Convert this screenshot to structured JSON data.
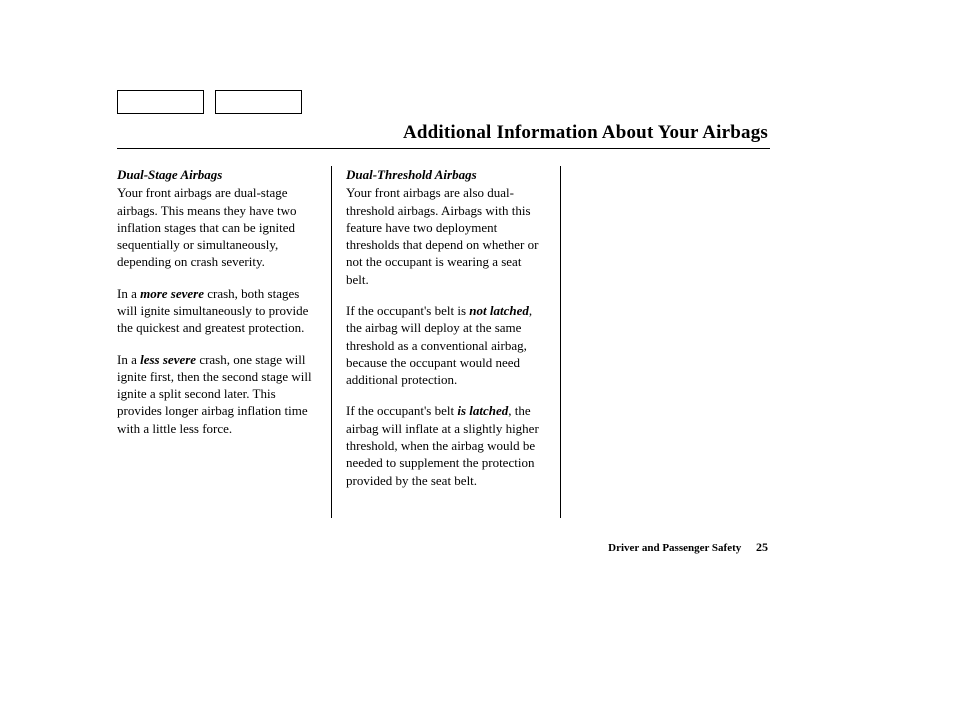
{
  "page_title": "Additional Information About Your Airbags",
  "footer": {
    "section": "Driver and Passenger Safety",
    "page_number": "25"
  },
  "col1": {
    "heading": "Dual-Stage Airbags",
    "p1": "Your front airbags are dual-stage airbags. This means they have two inflation stages that can be ignited sequentially or simultaneously, depending on crash severity.",
    "p2a": "In a ",
    "p2em": "more severe",
    "p2b": " crash, both stages will ignite simultaneously to provide the quickest and greatest protection.",
    "p3a": "In a ",
    "p3em": "less severe",
    "p3b": " crash, one stage will ignite first, then the second stage will ignite a split second later. This provides longer airbag inflation time with a little less force."
  },
  "col2": {
    "heading": "Dual-Threshold Airbags",
    "p1": "Your front airbags are also dual-threshold airbags. Airbags with this feature have two deployment thresholds that depend on whether or not the occupant is wearing a seat belt.",
    "p2a": "If the occupant's belt is ",
    "p2em": "not latched",
    "p2b": ", the airbag will deploy at the same threshold as a conventional airbag, because the occupant would need additional protection.",
    "p3a": "If the occupant's belt ",
    "p3em": "is latched",
    "p3b": ", the airbag will inflate at a slightly higher threshold, when the airbag would be needed to supplement the protection provided by the seat belt."
  }
}
